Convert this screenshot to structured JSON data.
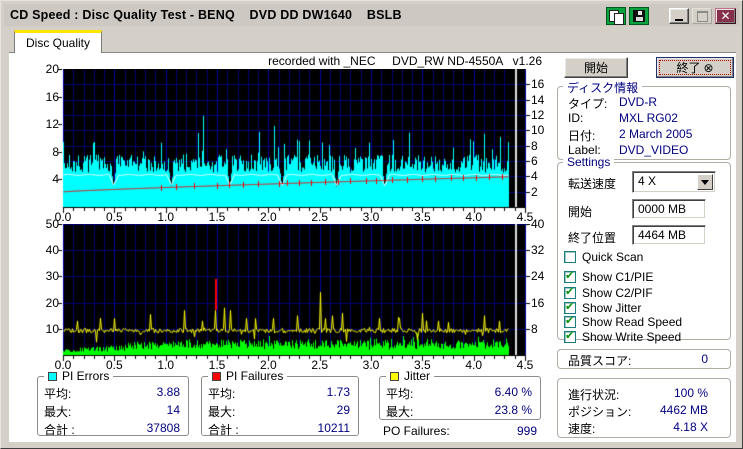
{
  "window": {
    "title": "CD Speed : Disc Quality Test - BENQ    DVD DD DW1640    BSLB"
  },
  "tab": {
    "label": "Disc Quality"
  },
  "chart_header": "recorded with _NEC     DVD_RW ND-4550A   v1.26",
  "colors": {
    "pie": "#00ffff",
    "pif": "#00ff00",
    "jitter": "#ffff00",
    "failure": "#ff0000",
    "value_text": "#000080",
    "chart_bg": "#000000",
    "grid": "#000074",
    "tab_accent": "#ffe400"
  },
  "chart_data": [
    {
      "id": "c1",
      "type": "area",
      "name": "PI Errors scan",
      "x": {
        "min": 0,
        "max": 4.5,
        "label_step": 0.5,
        "minor_step": 0.1,
        "tick_labels": [
          "0.0",
          "0.5",
          "1.0",
          "1.5",
          "2.0",
          "2.5",
          "3.0",
          "3.5",
          "4.0",
          "4.5"
        ]
      },
      "left_axis": {
        "min": 0,
        "max": 20,
        "ticks": [
          4,
          8,
          12,
          16,
          20
        ]
      },
      "right_axis": {
        "min": 0,
        "max": 18,
        "ticks": [
          2,
          4,
          6,
          8,
          10,
          12,
          14,
          16
        ]
      },
      "data_end_x": 4.33,
      "position_marker_x": 4.4,
      "series": [
        {
          "name": "PI Errors",
          "type": "area",
          "color": "#00ffff",
          "seed": 7,
          "base": 5.0,
          "noise": 2.6,
          "spike_rate": 0.1,
          "spike_size": 4.5,
          "rare_rate": 0.02,
          "rare_size": 3.2,
          "max": 14,
          "average": 3.88,
          "total": 37808
        },
        {
          "name": "Read Speed",
          "type": "level-line",
          "color": "#ffffff",
          "level": 4.65,
          "dips": [
            0.49,
            1.05,
            1.62,
            2.13,
            2.66,
            3.13
          ],
          "dip_depth": 1.55,
          "dip_width": 0.045
        },
        {
          "name": "Write Speed",
          "type": "rising-line",
          "color": "#ff0000",
          "start": 2.2,
          "end": 4.38,
          "curve": 0.85,
          "tick_xs": [
            0.95,
            1.1,
            1.28,
            1.5,
            1.62,
            1.75,
            1.9,
            2.1,
            2.18,
            2.3,
            2.42,
            2.55,
            2.68,
            2.8,
            2.95,
            3.05,
            3.2,
            3.35,
            3.5,
            3.62,
            3.78,
            3.9,
            4.02,
            4.15,
            4.28
          ]
        }
      ]
    },
    {
      "id": "c2",
      "type": "area",
      "name": "PI Failures / Jitter scan",
      "x": {
        "min": 0,
        "max": 4.5,
        "label_step": 0.5,
        "minor_step": 0.1,
        "tick_labels": [
          "0.0",
          "0.5",
          "1.0",
          "1.5",
          "2.0",
          "2.5",
          "3.0",
          "3.5",
          "4.0",
          "4.5"
        ]
      },
      "left_axis": {
        "min": 0,
        "max": 50,
        "ticks": [
          10,
          20,
          30,
          40,
          50
        ]
      },
      "right_axis": {
        "min": 0,
        "max": 40,
        "ticks": [
          8,
          16,
          24,
          32,
          40
        ]
      },
      "data_end_x": 4.33,
      "position_marker_x": 4.4,
      "series": [
        {
          "name": "PI Failures",
          "type": "area",
          "color": "#00ff00",
          "seed": 13,
          "base": 2.0,
          "noise": 3.2,
          "growth": true,
          "spike_rate": 0.06,
          "spike_size": 2.2,
          "max": 9,
          "average": 1.73,
          "total": 10211
        },
        {
          "name": "Jitter",
          "type": "noisy-line",
          "color": "#ffff00",
          "seed": 21,
          "level": 9.3,
          "noise": 1.8,
          "up_rate": 0.045,
          "up_size": 5.5,
          "down_rate": 0.03,
          "down_size": 5,
          "big_spikes": [
            {
              "x": 0.14,
              "y": 13
            },
            {
              "x": 0.85,
              "y": 15.5
            },
            {
              "x": 1.18,
              "y": 17
            },
            {
              "x": 1.35,
              "y": 13
            },
            {
              "x": 1.48,
              "y": 17
            },
            {
              "x": 1.57,
              "y": 18
            },
            {
              "x": 1.63,
              "y": 17
            },
            {
              "x": 1.78,
              "y": 14
            },
            {
              "x": 2.05,
              "y": 14
            },
            {
              "x": 2.28,
              "y": 15
            },
            {
              "x": 2.5,
              "y": 24
            },
            {
              "x": 2.62,
              "y": 15
            },
            {
              "x": 2.72,
              "y": 16
            },
            {
              "x": 3.08,
              "y": 14
            },
            {
              "x": 3.5,
              "y": 16
            },
            {
              "x": 3.65,
              "y": 13
            },
            {
              "x": 4.1,
              "y": 15
            },
            {
              "x": 4.25,
              "y": 13
            }
          ]
        },
        {
          "name": "PO Failure spike",
          "type": "vspike",
          "color": "#ff0000",
          "x": 1.48,
          "y0": 17,
          "y1": 29
        }
      ]
    }
  ],
  "stats": {
    "pi_errors": {
      "legend": "PI Errors",
      "color": "#00ffff",
      "rows": [
        {
          "label": "平均:",
          "value": "3.88"
        },
        {
          "label": "最大:",
          "value": "14"
        },
        {
          "label": "合計 :",
          "value": "37808"
        }
      ]
    },
    "pi_failures": {
      "legend": "PI Failures",
      "color": "#ff0000",
      "rows": [
        {
          "label": "平均:",
          "value": "1.73"
        },
        {
          "label": "最大:",
          "value": "29"
        },
        {
          "label": "合計 :",
          "value": "10211"
        }
      ]
    },
    "jitter": {
      "legend": "Jitter",
      "color": "#ffff00",
      "rows": [
        {
          "label": "平均:",
          "value": "6.40 %"
        },
        {
          "label": "最大:",
          "value": "23.8 %"
        }
      ]
    },
    "po_failures": {
      "label": "PO Failures:",
      "value": "999"
    }
  },
  "panel": {
    "start_button": "開始",
    "exit_button": "終了",
    "disc_info": {
      "legend": "ディスク情報",
      "rows": [
        {
          "label": "タイプ:",
          "value": "DVD-R"
        },
        {
          "label": "ID:",
          "value": "MXL RG02"
        },
        {
          "label": "日付:",
          "value": "2 March 2005"
        },
        {
          "label": "Label:",
          "value": "DVD_VIDEO"
        }
      ]
    },
    "settings": {
      "legend": "Settings",
      "speed_label": "転送速度",
      "speed_value": "4 X",
      "start_label": "開始",
      "start_value": "0000 MB",
      "end_label": "終了位置",
      "end_value": "4464 MB",
      "checkboxes": [
        {
          "label": "Quick Scan",
          "checked": false
        },
        {
          "label": "Show C1/PIE",
          "checked": true
        },
        {
          "label": "Show C2/PIF",
          "checked": true
        },
        {
          "label": "Show Jitter",
          "checked": true
        },
        {
          "label": "Show Read Speed",
          "checked": true
        },
        {
          "label": "Show Write Speed",
          "checked": true
        }
      ]
    },
    "score": {
      "label": "品質スコア:",
      "value": "0"
    },
    "progress": {
      "rows": [
        {
          "label": "進行状況:",
          "value": "100 %"
        },
        {
          "label": "ポジション:",
          "value": "4462 MB"
        },
        {
          "label": "速度:",
          "value": "4.18 X"
        }
      ]
    }
  }
}
